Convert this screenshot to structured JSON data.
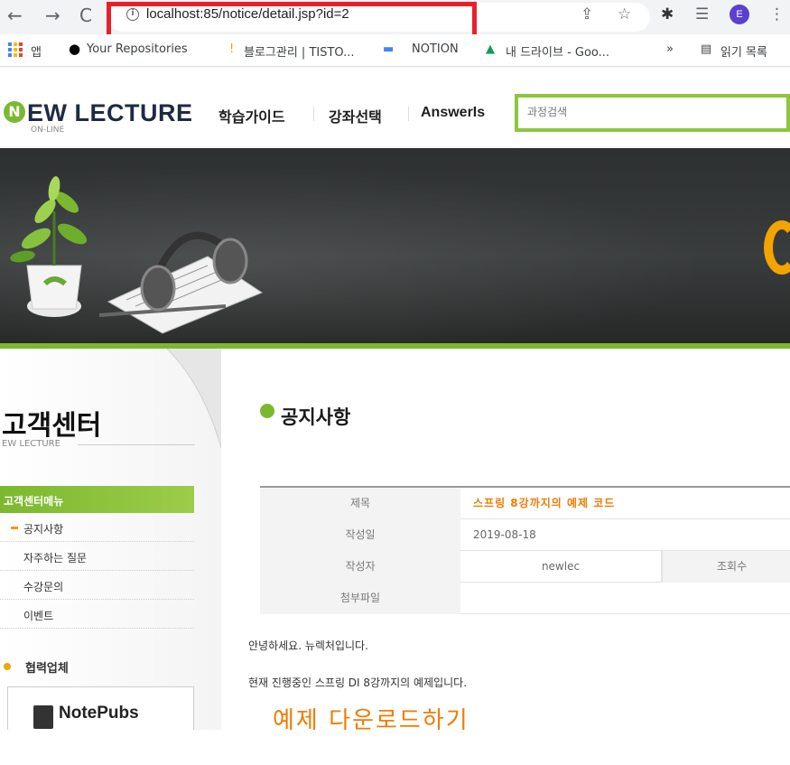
{
  "browser": {
    "url": "localhost:85/notice/detail.jsp?id=2",
    "profile_initial": "E",
    "bookmarks": [
      {
        "label": "앱"
      },
      {
        "label": "Your Repositories"
      },
      {
        "label": "블로그관리 | TISTO..."
      },
      {
        "label": "NOTION"
      },
      {
        "label": "내 드라이브 - Goo..."
      },
      {
        "label": "»"
      },
      {
        "label": "읽기 목록"
      }
    ]
  },
  "header": {
    "logo_main": "EW LECTURE",
    "logo_sub": "ON-LINE",
    "nav": [
      "학습가이드",
      "강좌선택",
      "AnswerIs"
    ],
    "search_placeholder": "과정검색"
  },
  "sidebar": {
    "title": "고객센터",
    "subtitle": "EW LECTURE",
    "menu_header": "고객센터메뉴",
    "items": [
      {
        "label": "공지사항",
        "active": true
      },
      {
        "label": "자주하는 질문"
      },
      {
        "label": "수강문의"
      },
      {
        "label": "이벤트"
      }
    ],
    "partner_label": "협력업체",
    "partner_name": "NotePubs"
  },
  "main": {
    "title": "공지사항",
    "detail": {
      "title_label": "제목",
      "title_value": "스프링 8강까지의 예제 코드",
      "date_label": "작성일",
      "date_value": "2019-08-18",
      "writer_label": "작성자",
      "writer_value": "newlec",
      "views_label": "조회수",
      "file_label": "첨부파일",
      "file_value": ""
    },
    "content_line1": "안녕하세요. 뉴렉처입니다.",
    "content_line2": "현재 진행중인 스프링 DI 8강까지의 예제입니다.",
    "download_text": "예제 다운로드하기"
  },
  "colors": {
    "accent_green": "#7cb82f",
    "accent_orange": "#f07c00",
    "highlight_red": "#e8202a"
  }
}
